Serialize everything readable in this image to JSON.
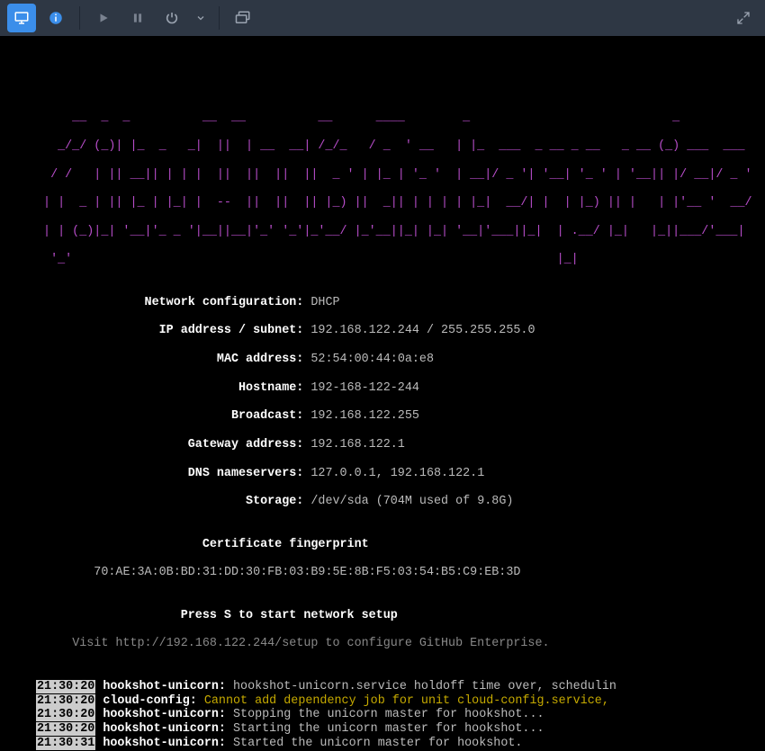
{
  "toolbar": {
    "monitor_icon": "monitor",
    "info_icon": "info",
    "play_icon": "play",
    "pause_icon": "pause",
    "power_icon": "power",
    "dropdown_icon": "chevron-down",
    "screens_icon": "screens",
    "popout_icon": "popout"
  },
  "ascii": {
    "l1": "     __  _  _          __  __          __      ____        _                            _            ",
    "l2": "   _/_/ (_)| |_  _   _|  ||  | __  __| /_/_   / _  ' __   | |_  ___  _ __ _ __   _ __ (_) ___  ___  ",
    "l3": "  / /   | || __|| | | |  ||  ||  ||  ||  _ ' | |_ | '_ '  | __|/ _ '| '__| '_ ' | '__|| |/ __|/ _ ' ",
    "l4": " | |  _ | || |_ | |_| |  --  ||  ||  || |_) ||  _|| | | | | |_|  __/| |  | |_) || |   | |'__ '  __/ ",
    "l5": " | | (_)|_| '__|'_ _ '|__||__|'_' '_'|_'__/ |_'__||_| |_| '__|'___||_|  | .__/ |_|   |_||___/'___| ",
    "l6": "  '_'                                                                   |_|                        "
  },
  "net": {
    "config_label": "Network configuration:",
    "config_value": "DHCP",
    "ip_label": "IP address / subnet:",
    "ip_value": "192.168.122.244 / 255.255.255.0",
    "mac_label": "MAC address:",
    "mac_value": "52:54:00:44:0a:e8",
    "host_label": "Hostname:",
    "host_value": "192-168-122-244",
    "bcast_label": "Broadcast:",
    "bcast_value": "192.168.122.255",
    "gw_label": "Gateway address:",
    "gw_value": "192.168.122.1",
    "dns_label": "DNS nameservers:",
    "dns_value": "127.0.0.1, 192.168.122.1",
    "storage_label": "Storage:",
    "storage_value": "/dev/sda (704M used of 9.8G)"
  },
  "cert": {
    "title": "Certificate fingerprint",
    "value": "70:AE:3A:0B:BD:31:DD:30:FB:03:B9:5E:8B:F5:03:54:B5:C9:EB:3D"
  },
  "prompt": {
    "press": "Press S to start network setup",
    "visit": "Visit http://192.168.122.244/setup to configure GitHub Enterprise."
  },
  "log": {
    "r0_ts": "21:30:20",
    "r0_src": "hookshot-unicorn:",
    "r0_msg": "hookshot-unicorn.service holdoff time over, schedulin",
    "r1_ts": "21:30:20",
    "r1_src": "cloud-config:",
    "r1_msg": "Cannot add dependency job for unit cloud-config.service,",
    "r2_ts": "21:30:20",
    "r2_src": "hookshot-unicorn:",
    "r2_msg": "Stopping the unicorn master for hookshot...",
    "r3_ts": "21:30:20",
    "r3_src": "hookshot-unicorn:",
    "r3_msg": "Starting the unicorn master for hookshot...",
    "r4_ts": "21:30:31",
    "r4_src": "hookshot-unicorn:",
    "r4_msg": "Started the unicorn master for hookshot."
  },
  "colors": {
    "toolbar_bg": "#2e3744",
    "active_btn": "#3b8eea",
    "ascii": "#b84dca",
    "label": "#ffffff",
    "value": "#bbbbbb",
    "warn": "#c6aa00",
    "ts_bg": "#cccccc",
    "ts_fg": "#000000"
  }
}
